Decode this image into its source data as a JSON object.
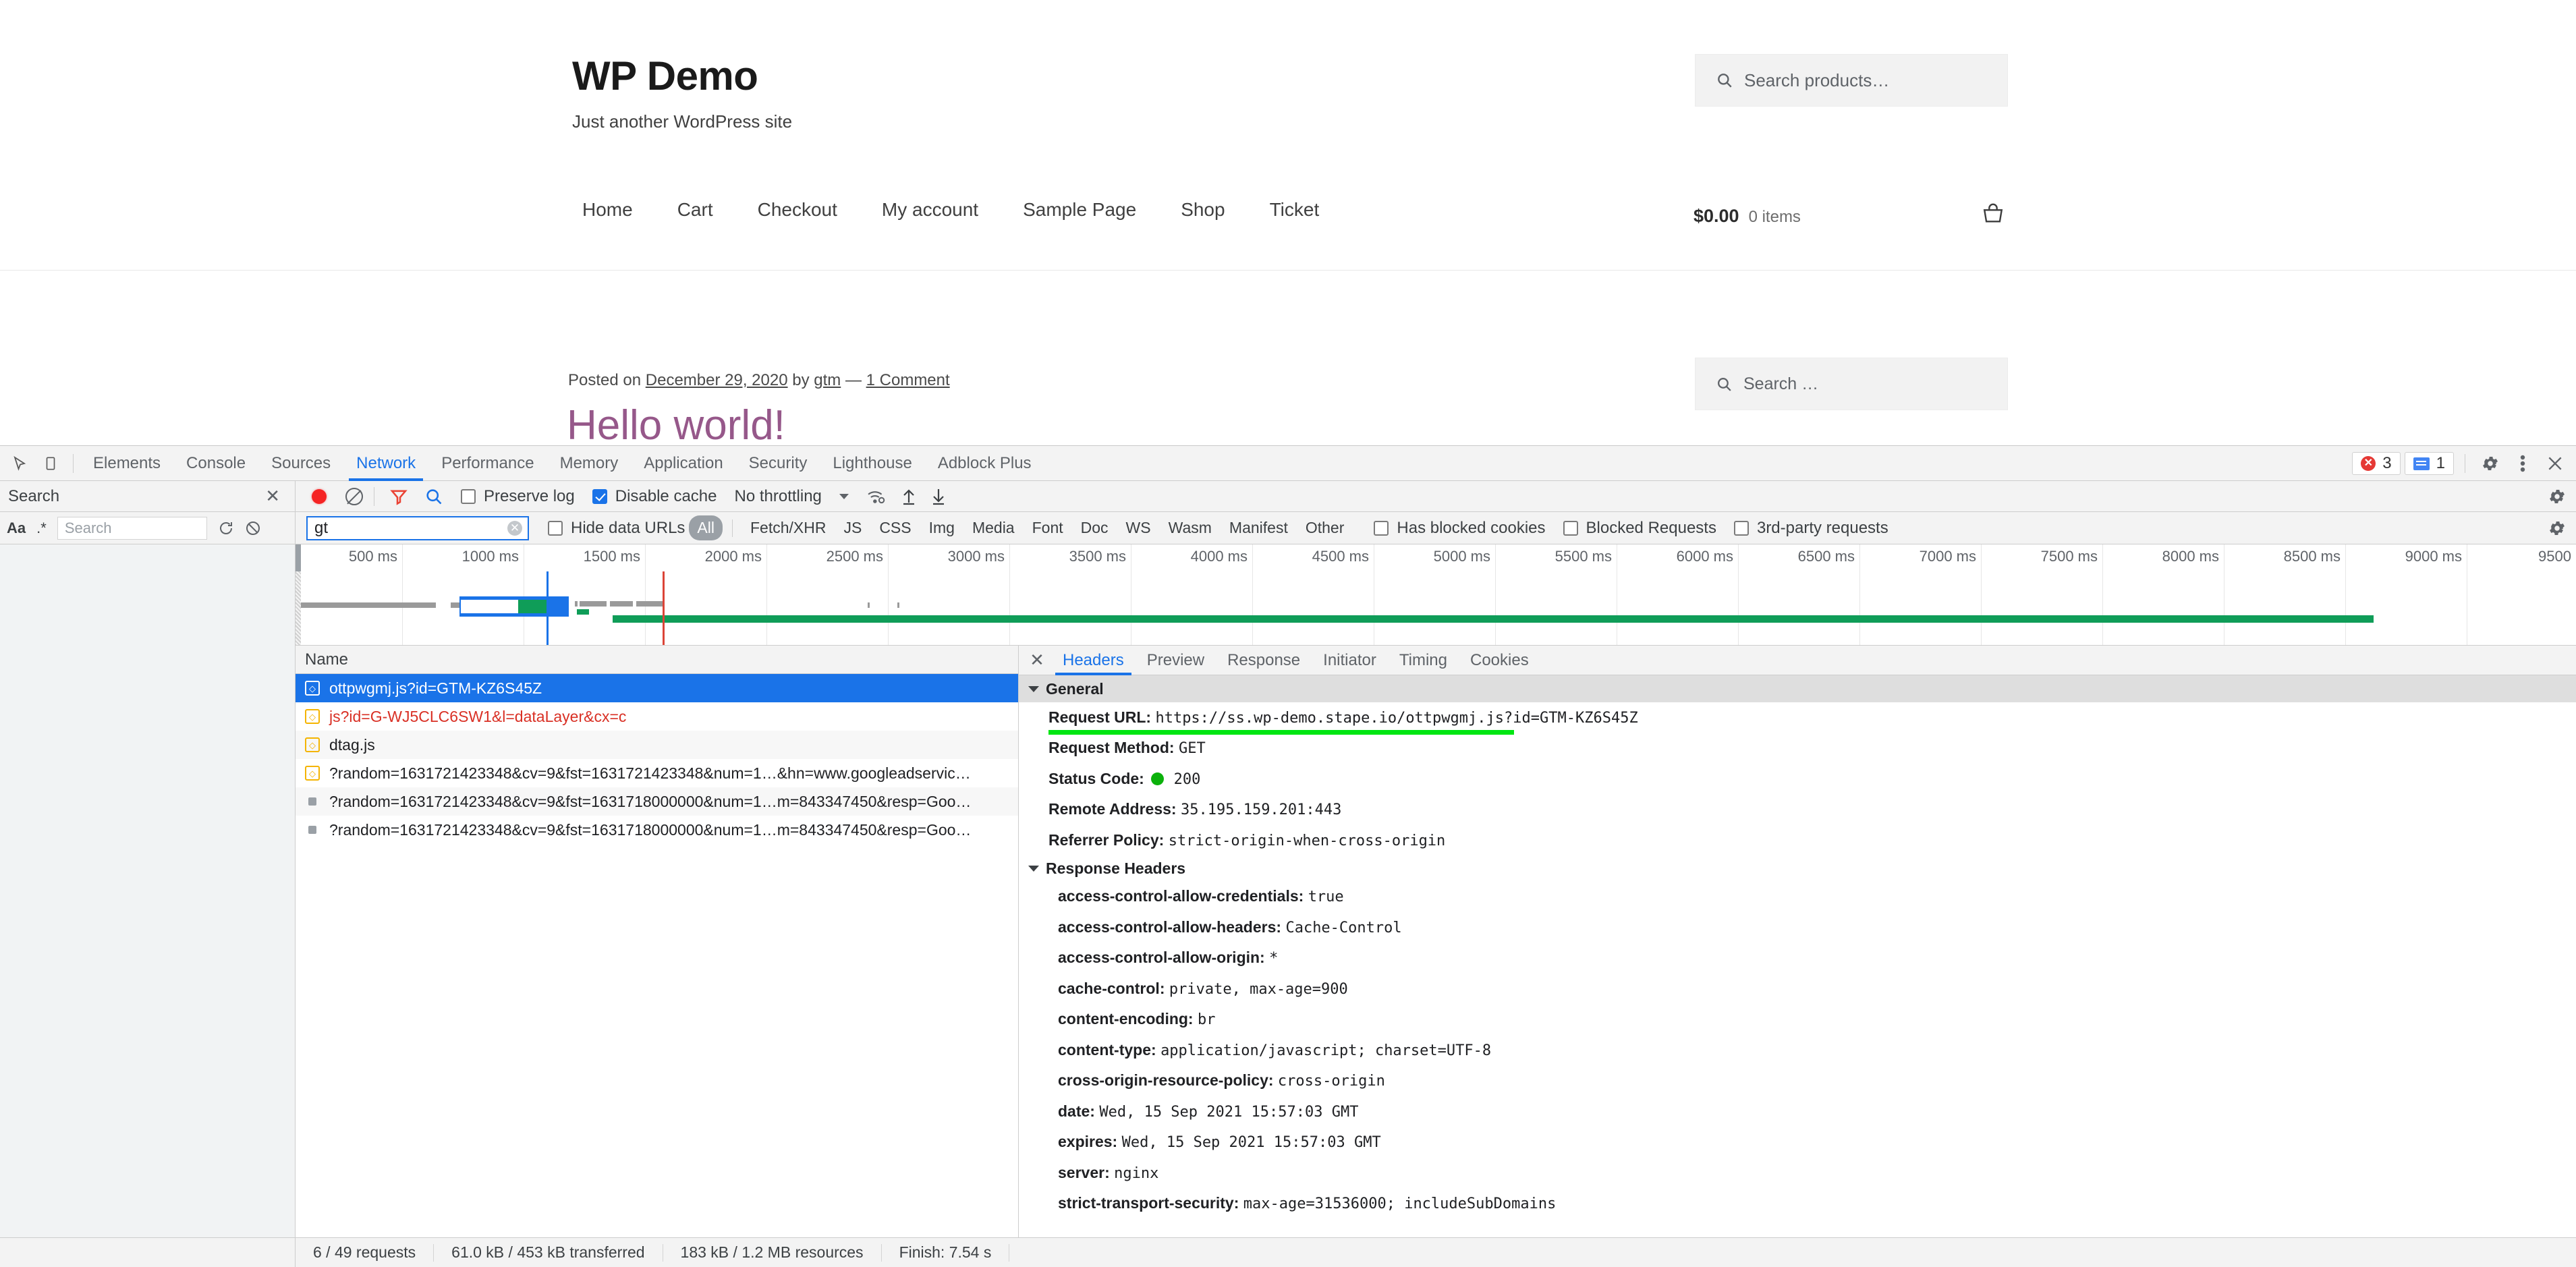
{
  "wordpress": {
    "site_title": "WP Demo",
    "tagline": "Just another WordPress site",
    "nav": [
      {
        "label": "Home"
      },
      {
        "label": "Cart"
      },
      {
        "label": "Checkout"
      },
      {
        "label": "My account"
      },
      {
        "label": "Sample Page"
      },
      {
        "label": "Shop"
      },
      {
        "label": "Ticket"
      }
    ],
    "product_search_placeholder": "Search products…",
    "cart_amount": "$0.00",
    "cart_items": "0 items",
    "post_meta_prefix": "Posted on",
    "post_date": "December 29, 2020",
    "post_by": "by",
    "post_author": "gtm",
    "post_dash": "—",
    "post_comments": "1 Comment",
    "post_title": "Hello world!",
    "sidebar_search_placeholder": "Search …"
  },
  "devtools": {
    "tabs": [
      {
        "label": "Elements",
        "active": false
      },
      {
        "label": "Console",
        "active": false
      },
      {
        "label": "Sources",
        "active": false
      },
      {
        "label": "Network",
        "active": true
      },
      {
        "label": "Performance",
        "active": false
      },
      {
        "label": "Memory",
        "active": false
      },
      {
        "label": "Application",
        "active": false
      },
      {
        "label": "Security",
        "active": false
      },
      {
        "label": "Lighthouse",
        "active": false
      },
      {
        "label": "Adblock Plus",
        "active": false
      }
    ],
    "error_count": "3",
    "warning_count": "1",
    "toolbar": {
      "search_panel_label": "Search",
      "preserve_log_label": "Preserve log",
      "preserve_log_checked": false,
      "disable_cache_label": "Disable cache",
      "disable_cache_checked": true,
      "throttling_label": "No throttling"
    },
    "search_panel": {
      "match_case_label": "Aa",
      "regex_label": ".*",
      "input_placeholder": "Search"
    },
    "filterbar": {
      "filter_value": "gt",
      "hide_data_urls_label": "Hide data URLs",
      "hide_data_urls_checked": false,
      "types": [
        "All",
        "Fetch/XHR",
        "JS",
        "CSS",
        "Img",
        "Media",
        "Font",
        "Doc",
        "WS",
        "Wasm",
        "Manifest",
        "Other"
      ],
      "active_type": "All",
      "has_blocked_cookies_label": "Has blocked cookies",
      "has_blocked_cookies_checked": false,
      "blocked_requests_label": "Blocked Requests",
      "blocked_requests_checked": false,
      "third_party_label": "3rd-party requests",
      "third_party_checked": false
    },
    "overview": {
      "ticks": [
        "500 ms",
        "1000 ms",
        "1500 ms",
        "2000 ms",
        "2500 ms",
        "3000 ms",
        "3500 ms",
        "4000 ms",
        "4500 ms",
        "5000 ms",
        "5500 ms",
        "6000 ms",
        "6500 ms",
        "7000 ms",
        "7500 ms",
        "8000 ms",
        "8500 ms",
        "9000 ms",
        "9500"
      ]
    },
    "requests": {
      "column_name": "Name",
      "rows": [
        {
          "name": "ottpwgmj.js?id=GTM-KZ6S45Z",
          "selected": true,
          "icon": "js-icon",
          "style": "normal"
        },
        {
          "name": "js?id=G-WJ5CLC6SW1&l=dataLayer&cx=c",
          "selected": false,
          "icon": "js-icon",
          "style": "error"
        },
        {
          "name": "dtag.js",
          "selected": false,
          "icon": "js-icon",
          "style": "normal"
        },
        {
          "name": "?random=1631721423348&cv=9&fst=1631721423348&num=1…&hn=www.googleadservic…",
          "selected": false,
          "icon": "js-icon",
          "style": "normal"
        },
        {
          "name": "?random=1631721423348&cv=9&fst=1631718000000&num=1…m=843347450&resp=Goo…",
          "selected": false,
          "icon": "dot-icon",
          "style": "normal"
        },
        {
          "name": "?random=1631721423348&cv=9&fst=1631718000000&num=1…m=843347450&resp=Goo…",
          "selected": false,
          "icon": "dot-icon",
          "style": "normal"
        }
      ]
    },
    "detail": {
      "tabs": [
        {
          "label": "Headers",
          "active": true
        },
        {
          "label": "Preview",
          "active": false
        },
        {
          "label": "Response",
          "active": false
        },
        {
          "label": "Initiator",
          "active": false
        },
        {
          "label": "Timing",
          "active": false
        },
        {
          "label": "Cookies",
          "active": false
        }
      ],
      "general_section": "General",
      "general": [
        {
          "key": "Request URL:",
          "value": "https://ss.wp-demo.stape.io/ottpwgmj.js?id=GTM-KZ6S45Z",
          "highlight": true
        },
        {
          "key": "Request Method:",
          "value": "GET"
        },
        {
          "key": "Status Code:",
          "value": "200",
          "status_dot": true
        },
        {
          "key": "Remote Address:",
          "value": "35.195.159.201:443"
        },
        {
          "key": "Referrer Policy:",
          "value": "strict-origin-when-cross-origin"
        }
      ],
      "response_section": "Response Headers",
      "response_headers": [
        {
          "key": "access-control-allow-credentials:",
          "value": "true"
        },
        {
          "key": "access-control-allow-headers:",
          "value": "Cache-Control"
        },
        {
          "key": "access-control-allow-origin:",
          "value": "*"
        },
        {
          "key": "cache-control:",
          "value": "private, max-age=900"
        },
        {
          "key": "content-encoding:",
          "value": "br"
        },
        {
          "key": "content-type:",
          "value": "application/javascript; charset=UTF-8"
        },
        {
          "key": "cross-origin-resource-policy:",
          "value": "cross-origin"
        },
        {
          "key": "date:",
          "value": "Wed, 15 Sep 2021 15:57:03 GMT"
        },
        {
          "key": "expires:",
          "value": "Wed, 15 Sep 2021 15:57:03 GMT"
        },
        {
          "key": "server:",
          "value": "nginx"
        },
        {
          "key": "strict-transport-security:",
          "value": "max-age=31536000; includeSubDomains"
        }
      ]
    },
    "status_bar": {
      "requests": "6 / 49 requests",
      "transferred": "61.0 kB / 453 kB transferred",
      "resources": "183 kB / 1.2 MB resources",
      "finish": "Finish: 7.54 s"
    }
  },
  "colors": {
    "accent_blue": "#1a73e8",
    "error_red": "#d93025",
    "success_green": "#0f9d58",
    "highlight_green": "#00e612",
    "wp_purple": "#96588a"
  }
}
